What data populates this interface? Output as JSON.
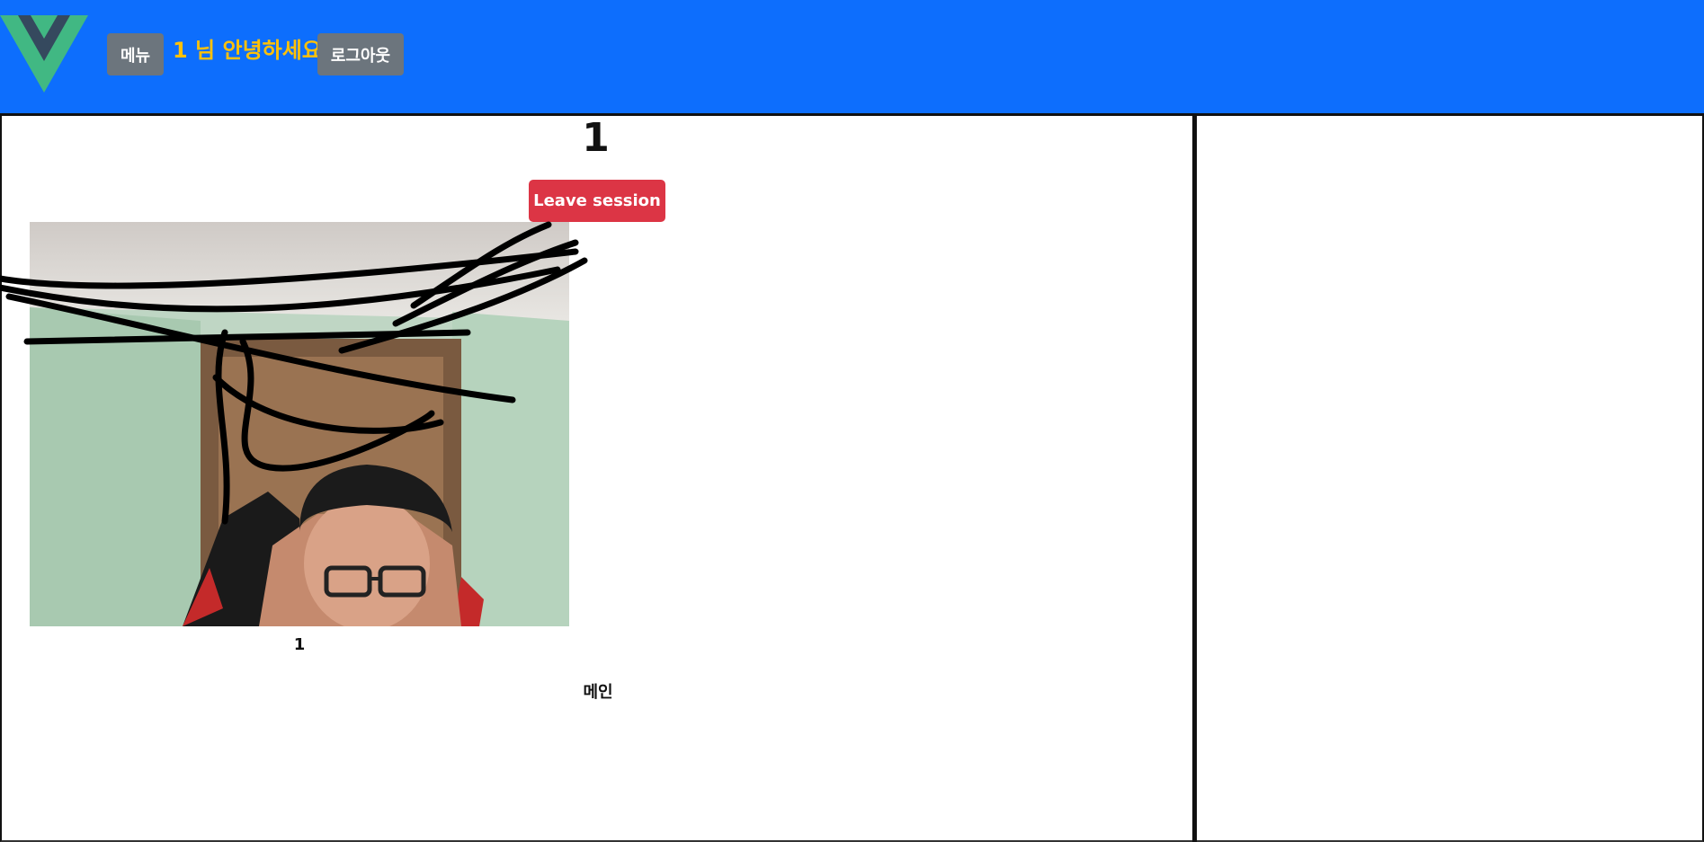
{
  "header": {
    "menu_label": "메뉴",
    "greeting": "1 님 안녕하세요",
    "logout_label": "로그아웃",
    "logo_icon": "vue-logo-icon",
    "background_color": "#0d6efd",
    "greeting_color": "#ffc107"
  },
  "session": {
    "title": "1",
    "leave_label": "Leave session",
    "leave_color": "#dc3545"
  },
  "video": {
    "participant_name": "1"
  },
  "main": {
    "label": "메인"
  }
}
